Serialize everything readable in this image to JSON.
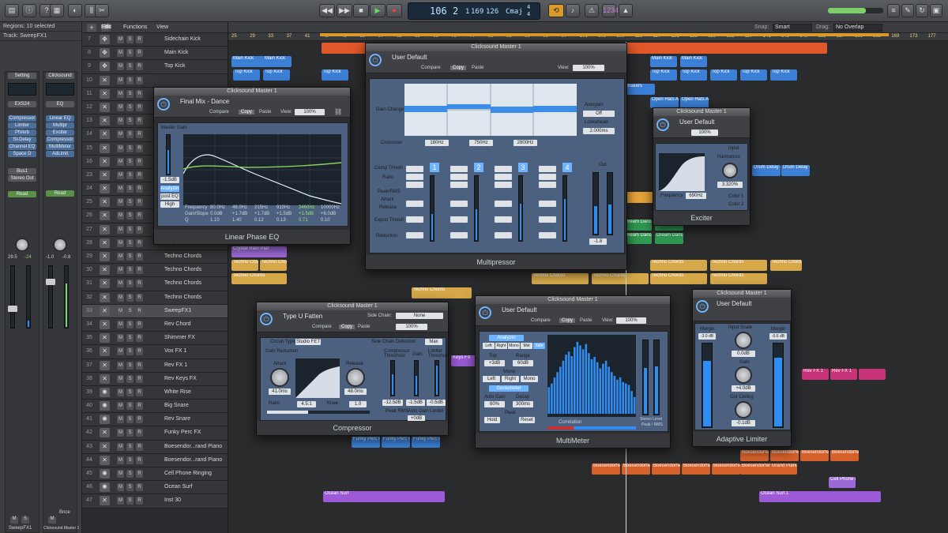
{
  "control_bar": {
    "lcd": {
      "bar": "106",
      "beat": "2",
      "div": "1",
      "tick": "169",
      "tempo": "126",
      "key": "Cmaj",
      "sig_top": "4",
      "sig_bottom": "4"
    },
    "cpu_label": "1234"
  },
  "inspector": {
    "regions_label": "Regions: 10 selected",
    "track_label": "Track: SweepFX1",
    "strip1": {
      "setting": "Setting",
      "eq": "EXS24",
      "inserts": [
        "Compressor",
        "Limiter",
        "PtVerb",
        "St-Delay",
        "Channel EQ",
        "Space D"
      ],
      "send": "Bus1",
      "output": "Stereo Out",
      "mode": "Read",
      "pan_values": "29.5",
      "db_value": "-24",
      "name": "SweepFX1",
      "mute": "M",
      "solo": "S"
    },
    "strip2": {
      "setting": "Clicksound",
      "eq": "EQ",
      "inserts": [
        "Linear EQ",
        "Multipr",
        "Exciter",
        "Compressor",
        "MultiMeter",
        "AdLimit"
      ],
      "mode": "Read",
      "db_left": "-1.0",
      "db_right": "-0.8",
      "name": "Clicksound Master 1",
      "mute": "M",
      "bnce": "Bnce"
    }
  },
  "arrange_menu": {
    "edit": "Edit",
    "functions": "Functions",
    "view": "View",
    "snap_label": "Snap:",
    "snap_value": "Smart",
    "drag_label": "Drag:",
    "drag_value": "No Overlap"
  },
  "ruler": {
    "marks": [
      "25",
      "29",
      "33",
      "37",
      "41",
      "45",
      "49",
      "53",
      "57",
      "61",
      "65",
      "69",
      "73",
      "77",
      "81",
      "85",
      "89",
      "93",
      "97",
      "101",
      "105",
      "109",
      "113",
      "117",
      "121",
      "125",
      "129",
      "133",
      "137",
      "141",
      "145",
      "149",
      "153",
      "157",
      "161",
      "165",
      "169",
      "173",
      "177"
    ]
  },
  "tracks": [
    {
      "num": "7",
      "name": "Sidechain Kick"
    },
    {
      "num": "8",
      "name": "Main Kick"
    },
    {
      "num": "9",
      "name": "Top Kick"
    },
    {
      "num": "10",
      "name": ""
    },
    {
      "num": "11",
      "name": ""
    },
    {
      "num": "12",
      "name": ""
    },
    {
      "num": "13",
      "name": ""
    },
    {
      "num": "14",
      "name": ""
    },
    {
      "num": "15",
      "name": ""
    },
    {
      "num": "16",
      "name": ""
    },
    {
      "num": "23",
      "name": ""
    },
    {
      "num": "24",
      "name": ""
    },
    {
      "num": "25",
      "name": ""
    },
    {
      "num": "26",
      "name": ""
    },
    {
      "num": "27",
      "name": ""
    },
    {
      "num": "28",
      "name": "Crystal Rain"
    },
    {
      "num": "29",
      "name": "Techno Chords"
    },
    {
      "num": "30",
      "name": "Techno Chords"
    },
    {
      "num": "31",
      "name": "Techno Chords"
    },
    {
      "num": "32",
      "name": "Techno Chords"
    },
    {
      "num": "33",
      "name": "SweepFX1"
    },
    {
      "num": "34",
      "name": "Rev Chord"
    },
    {
      "num": "35",
      "name": "Shimmer FX"
    },
    {
      "num": "36",
      "name": "Vox FX 1"
    },
    {
      "num": "37",
      "name": "Rev FX 1"
    },
    {
      "num": "38",
      "name": "Rev Keys FX"
    },
    {
      "num": "39",
      "name": "White Rise"
    },
    {
      "num": "40",
      "name": "Big Snare"
    },
    {
      "num": "41",
      "name": "Rev Snare"
    },
    {
      "num": "42",
      "name": "Funky Perc FX"
    },
    {
      "num": "43",
      "name": "Boesendor...rand Piano"
    },
    {
      "num": "44",
      "name": "Boesendor...rand Piano"
    },
    {
      "num": "45",
      "name": "Cell Phone Ringing"
    },
    {
      "num": "46",
      "name": "Ocean Surf"
    },
    {
      "num": "47",
      "name": "Inst 30"
    }
  ],
  "regions": {
    "main_kick": "Main Kick",
    "top_kick": "Top Kick",
    "crystal_rain": "Crystal Rain Pad",
    "techno_chords": "Techno Chords",
    "funky_perc": "Funky Perc F",
    "boesendorfer": "Boesendorfer",
    "boesendorfer_grand": "Boesendorfer Grand Piano",
    "ocean_surf": "Ocean Surf",
    "ocean_surf1": "Ocean Surf.1",
    "rev_fx": "Rev FX 1",
    "cell_phone": "Cell Phone R",
    "shakers": "Shakers",
    "open_hats": "Open Hats A",
    "dream_dancers": "Dream Dancers",
    "drum_delay": "Drum Delay F",
    "keys_fx": "Keys FX"
  },
  "plugins": {
    "linear_eq": {
      "title": "Clicksound Master 1",
      "preset": "Final Mix - Dance",
      "compare": "Compare",
      "copy": "Copy",
      "paste": "Paste",
      "view_label": "View:",
      "view": "100%",
      "name": "Linear Phase EQ",
      "master_gain_label": "Master Gain",
      "master_gain": "-1.5dB",
      "analyzer": "Analyzer",
      "post_eq": "post EQ",
      "high": "High",
      "freq_label": "Frequency",
      "gain_slope_label": "Gain/Slope",
      "q_label": "Q",
      "freqs": [
        "80.0Hz",
        "48.0Hz",
        "215Hz",
        "910Hz",
        "3460Hz",
        "10000Hz"
      ],
      "gains": [
        "0.0dB",
        "+1.7dB",
        "+1.7dB",
        "+1.5dB",
        "+1.5dB",
        "+6.0dB"
      ],
      "qs": [
        "1.10",
        "1.40",
        "0.12",
        "0.13",
        "0.71",
        "0.10"
      ],
      "db_scale": [
        "+12",
        "+9",
        "+6",
        "+3",
        "0",
        "-3",
        "-6",
        "-9",
        "-12"
      ]
    },
    "multipressor": {
      "title": "Clicksound Master 1",
      "preset": "User Default",
      "compare": "Compare",
      "copy": "Copy",
      "paste": "Paste",
      "view_label": "View:",
      "view": "100%",
      "name": "Multipressor",
      "gain_change": "Gain Change",
      "crossover": "Crossover",
      "autogain": "Autogain",
      "autogain_val": "Off",
      "lookahead": "Lookahead",
      "lookahead_val": "2.000ms",
      "band_nums": [
        "1",
        "2",
        "3",
        "4"
      ],
      "comp_thresh": "Comp Thresh",
      "ratio": "Ratio",
      "peak_rms": "Peak/RMS",
      "attack": "Attack",
      "release": "Release",
      "expnd_thresh": "Expnd Thresh",
      "reduction": "Reduction",
      "gain_label": "Gain",
      "xover_vals": [
        "180Hz",
        "750Hz",
        "2800Hz"
      ],
      "out_label": "Out",
      "out_val": "-1.8"
    },
    "exciter": {
      "title": "Clicksound Master 1",
      "preset": "User Default",
      "view": "100%",
      "name": "Exciter",
      "input": "Input",
      "harmonics": "Harmonics",
      "harmonics_val": "3.320%",
      "frequency": "Frequency",
      "frequency_val": "690Hz",
      "color1": "Color 1",
      "color2": "Color 2"
    },
    "compressor": {
      "title": "Clicksound Master 1",
      "preset": "Type U Fatten",
      "compare": "Compare",
      "copy": "Copy",
      "paste": "Paste",
      "sidechain_label": "Side Chain:",
      "sidechain": "None",
      "view": "100%",
      "name": "Compressor",
      "circuit_type_label": "Circuit Type",
      "circuit_type": "Studio FET",
      "sidechain_detection": "Side Chain Detection",
      "sc_mode": "Max",
      "gain_reduction": "Gain Reduction",
      "attack": "Attack",
      "attack_val": "41.0ms",
      "release": "Release",
      "release_val": "48.0ms",
      "ratio": "Ratio",
      "ratio_val": "4.5:1",
      "knee": "Knee",
      "knee_val": "1.0",
      "threshold": "Compressor Threshold",
      "threshold_val": "-12.5dB",
      "peak_rms": "Peak RMS",
      "gain": "Gain",
      "gain_val": "-1.5dB",
      "auto_gain": "Auto Gain",
      "auto_gain_val": "+0dB",
      "limiter_thresh": "Limiter Threshold",
      "limiter_val": "-0.5dB",
      "limiter": "Limiter",
      "scale": [
        "-60",
        "-30",
        "-20",
        "-15",
        "-10",
        "-5",
        "0"
      ]
    },
    "multimeter": {
      "title": "Clicksound Master 1",
      "preset": "User Default",
      "compare": "Compare",
      "copy": "Copy",
      "paste": "Paste",
      "view_label": "View:",
      "view": "100%",
      "name": "MultiMeter",
      "analyzer": "Analyzer",
      "modes": [
        "Left",
        "Right",
        "Mono",
        "Mid",
        "Side"
      ],
      "top": "Top",
      "top_val": "+3dB",
      "range": "Range",
      "range_val": "60dB",
      "mono": "Mono",
      "left": "Left",
      "right": "Right",
      "goniometer": "Goniometer",
      "auto_gain": "Auto Gain",
      "auto_gain_val": "60%",
      "decay": "Decay",
      "decay_val": "300ms",
      "peak": "Peak",
      "hold": "Hold",
      "reset": "Reset",
      "correlation": "Correlation",
      "stereo_level": "Stereo Level",
      "peak_rms": "Peak / RMS",
      "bands": [
        0.35,
        0.4,
        0.48,
        0.55,
        0.62,
        0.7,
        0.78,
        0.82,
        0.76,
        0.88,
        0.95,
        0.9,
        0.85,
        0.92,
        0.8,
        0.72,
        0.75,
        0.68,
        0.6,
        0.66,
        0.7,
        0.62,
        0.55,
        0.5,
        0.45,
        0.48,
        0.42,
        0.4,
        0.38,
        0.3,
        0.22
      ]
    },
    "adaptive_limiter": {
      "title": "Clicksound Master 1",
      "preset": "User Default",
      "name": "Adaptive Limiter",
      "input_scale": "Input Scale",
      "input_scale_val": "0.0dB",
      "gain": "Gain",
      "gain_val": "+4.0dB",
      "out_ceiling": "Out Ceiling",
      "out_ceiling_val": "-0.1dB",
      "margin": "Margin",
      "margin_l": "-3.0 dB",
      "margin_r": "-0.6 dB",
      "meter_l": 0.78,
      "meter_r": 0.82
    }
  }
}
